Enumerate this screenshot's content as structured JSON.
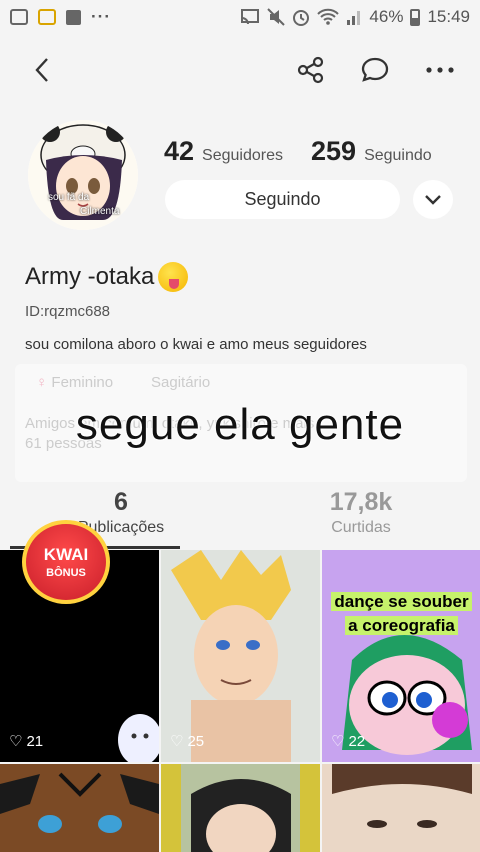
{
  "status_bar": {
    "battery": "46%",
    "time": "15:49",
    "overflow": "···"
  },
  "profile": {
    "followers_count": "42",
    "followers_label": "Seguidores",
    "following_count": "259",
    "following_label": "Seguindo",
    "follow_button": "Seguindo",
    "username": "Army -otaka",
    "user_id": "ID:rqzmc688",
    "bio": "sou comilona aboro o kwai e amo meus seguidores",
    "avatar_text_1": "sou fã da",
    "avatar_text_2": "Cilmenta"
  },
  "info": {
    "gender": "Feminino",
    "sign": "Sagitário",
    "friends_line1": "Amigos em comum: otaku, yukishiro e mais",
    "friends_line2": "61 pessoas"
  },
  "overlay_caption": "segue ela gente",
  "tabs": [
    {
      "count": "6",
      "label": "Publicações"
    },
    {
      "count": "17,8k",
      "label": "Curtidas"
    }
  ],
  "kwai_badge": {
    "line1": "KWAI",
    "line2": "BÔNUS"
  },
  "videos": [
    {
      "likes": "21"
    },
    {
      "likes": "25"
    },
    {
      "likes": "22",
      "caption_1": "dançe se souber",
      "caption_2": "a coreografia"
    },
    {
      "likes": ""
    },
    {
      "likes": ""
    },
    {
      "likes": ""
    }
  ]
}
